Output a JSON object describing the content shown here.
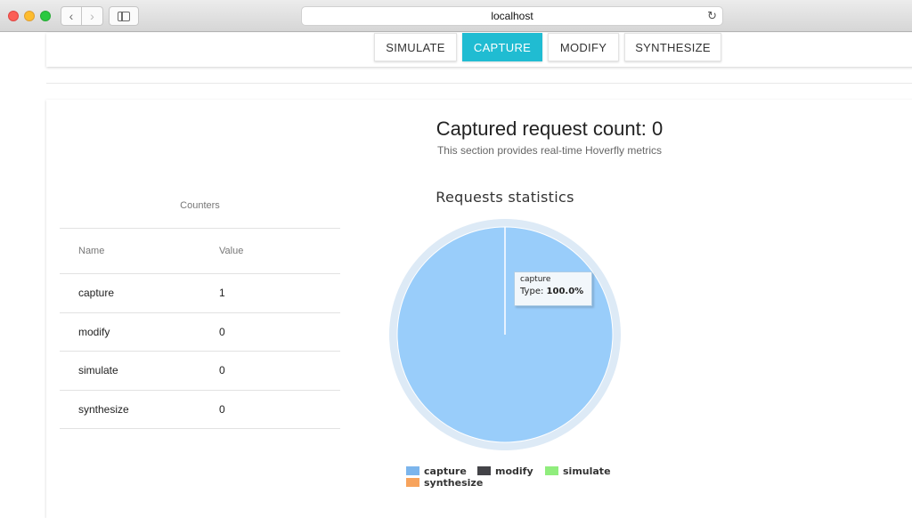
{
  "browser": {
    "url": "localhost",
    "back_icon": "chevron-left-icon",
    "forward_icon": "chevron-right-icon",
    "reload_icon": "reload-icon"
  },
  "nav": {
    "tabs": [
      {
        "label": "SIMULATE",
        "active": false
      },
      {
        "label": "CAPTURE",
        "active": true
      },
      {
        "label": "MODIFY",
        "active": false
      },
      {
        "label": "SYNTHESIZE",
        "active": false
      }
    ],
    "accent_color": "#20bcd2"
  },
  "header": {
    "title": "Captured request count: 0",
    "subtitle": "This section provides real-time Hoverfly metrics"
  },
  "counters": {
    "caption": "Counters",
    "columns": [
      "Name",
      "Value"
    ],
    "rows": [
      {
        "name": "capture",
        "value": "1"
      },
      {
        "name": "modify",
        "value": "0"
      },
      {
        "name": "simulate",
        "value": "0"
      },
      {
        "name": "synthesize",
        "value": "0"
      }
    ]
  },
  "chart_data": {
    "type": "pie",
    "title": "Requests statistics",
    "categories": [
      "capture",
      "modify",
      "simulate",
      "synthesize"
    ],
    "values": [
      1,
      0,
      0,
      0
    ],
    "colors": [
      "#7cb5ec",
      "#434348",
      "#90ed7d",
      "#f7a35c"
    ],
    "legend": "bottom",
    "tooltip": {
      "name": "capture",
      "label": "Type:",
      "value": "100.0%"
    }
  }
}
